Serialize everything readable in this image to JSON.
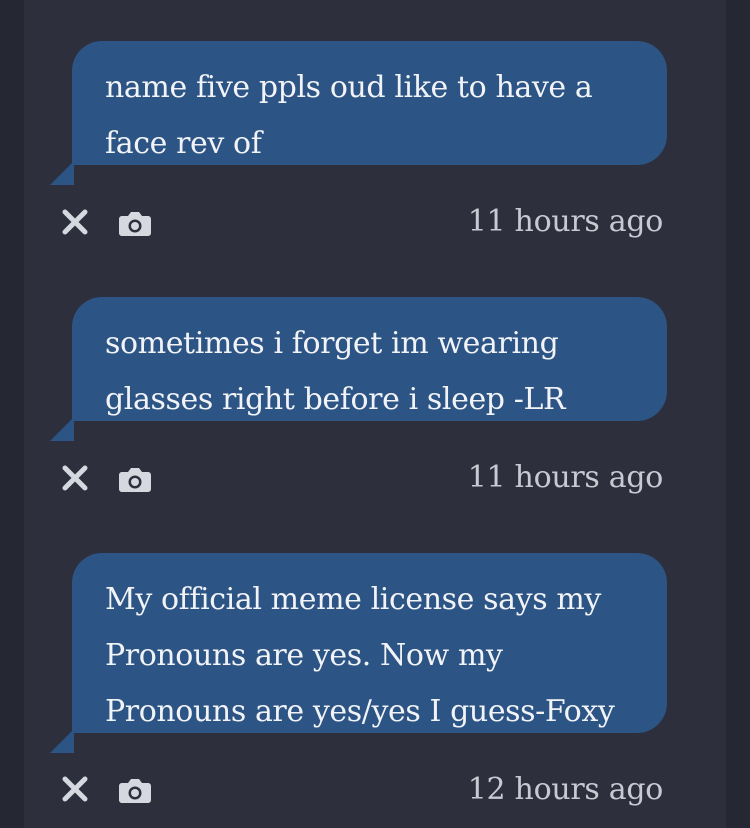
{
  "messages": [
    {
      "text": "name five ppls oud like to have a face rev of",
      "time": "11 hours ago",
      "delete_icon": "close-icon",
      "screenshot_icon": "camera-icon"
    },
    {
      "text": "sometimes i forget im wearing glasses right before i sleep -LR",
      "time": "11 hours ago",
      "delete_icon": "close-icon",
      "screenshot_icon": "camera-icon"
    },
    {
      "text": "My official meme license says my Pronouns are yes. Now my Pronouns are yes/yes I guess-Foxy",
      "time": "12 hours ago",
      "delete_icon": "close-icon",
      "screenshot_icon": "camera-icon"
    }
  ],
  "colors": {
    "background": "#252833",
    "panel": "#2d303c",
    "bubble": "#2c5586",
    "text": "#f2f3f6",
    "muted": "#c7cad2"
  }
}
